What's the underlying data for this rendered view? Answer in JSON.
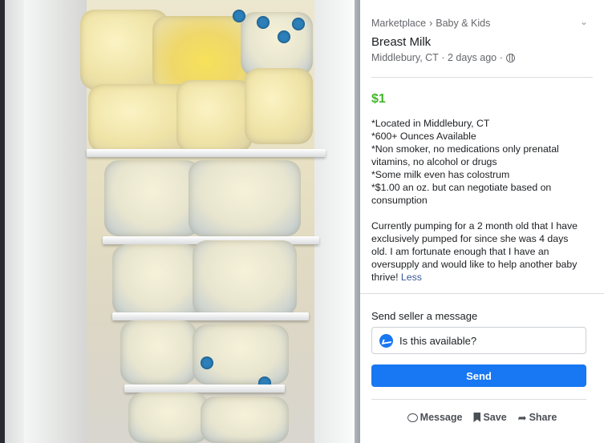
{
  "breadcrumb": {
    "parent": "Marketplace",
    "separator": "›",
    "category": "Baby & Kids"
  },
  "listing": {
    "title": "Breast Milk",
    "location": "Middlebury, CT",
    "posted": "2 days ago",
    "price": "$1",
    "description_lines": [
      "*Located in Middlebury, CT",
      "*600+ Ounces Available",
      "*Non smoker, no medications only prenatal",
      "vitamins, no alcohol or drugs",
      "*Some milk even has colostrum",
      "*$1.00 an oz. but can negotiate based on",
      "consumption"
    ],
    "description_paragraph": [
      "Currently pumping for a 2 month old that I have",
      "exclusively pumped for since she was 4 days",
      "old. I am fortunate enough that I have an",
      "oversupply and would like to help another baby",
      "thrive!"
    ],
    "less_link": "Less"
  },
  "message": {
    "label": "Send seller a message",
    "input_value": "Is this available?",
    "send_label": "Send"
  },
  "actions": {
    "message_label": "Message",
    "save_label": "Save",
    "share_label": "Share"
  },
  "colors": {
    "price": "#42b72a",
    "primary": "#1877f2",
    "link": "#385898"
  },
  "icons": [
    "chevron-down-icon",
    "globe-icon",
    "messenger-icon",
    "chat-bubble-icon",
    "bookmark-icon",
    "share-arrow-icon"
  ]
}
